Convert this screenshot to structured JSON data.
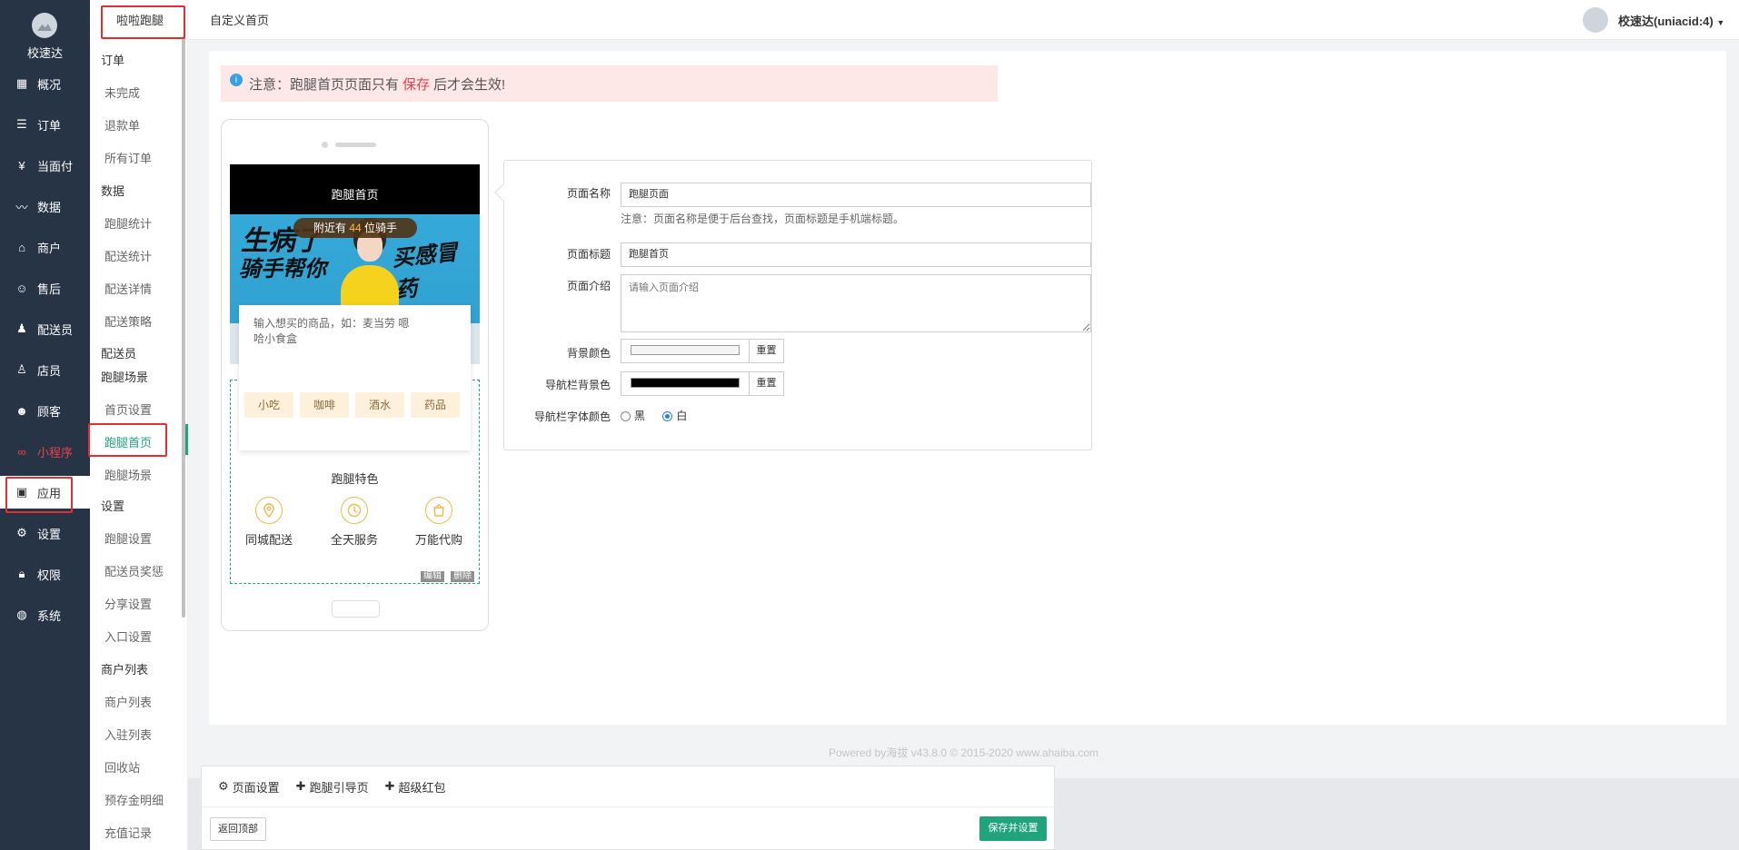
{
  "nav": {
    "brand": "校速达",
    "items": [
      {
        "label": "概况",
        "icon": "overview-icon"
      },
      {
        "label": "订单",
        "icon": "order-icon"
      },
      {
        "label": "当面付",
        "icon": "yen-icon"
      },
      {
        "label": "数据",
        "icon": "chart-icon"
      },
      {
        "label": "商户",
        "icon": "store-icon"
      },
      {
        "label": "售后",
        "icon": "service-icon"
      },
      {
        "label": "配送员",
        "icon": "courier-icon"
      },
      {
        "label": "店员",
        "icon": "clerk-icon"
      },
      {
        "label": "顾客",
        "icon": "customer-icon"
      },
      {
        "label": "小程序",
        "icon": "miniprogram-icon"
      },
      {
        "label": "应用",
        "icon": "apps-icon"
      },
      {
        "label": "设置",
        "icon": "gear-icon"
      },
      {
        "label": "权限",
        "icon": "lock-icon"
      },
      {
        "label": "系统",
        "icon": "system-icon"
      }
    ]
  },
  "subnav": {
    "top": "啦啦跑腿",
    "groups": [
      {
        "head": "订单",
        "items": [
          "未完成",
          "退款单",
          "所有订单"
        ]
      },
      {
        "head": "数据",
        "items": [
          "跑腿统计",
          "配送统计",
          "配送详情",
          "配送策略"
        ]
      },
      {
        "head": "配送员",
        "items": []
      },
      {
        "head": "跑腿场景",
        "items": [
          "首页设置",
          "跑腿首页",
          "跑腿场景"
        ]
      },
      {
        "head": "设置",
        "items": [
          "跑腿设置",
          "配送员奖惩",
          "分享设置",
          "入口设置"
        ]
      },
      {
        "head": "商户列表",
        "items": [
          "商户列表",
          "入驻列表",
          "回收站",
          "预存金明细",
          "充值记录"
        ]
      }
    ]
  },
  "header": {
    "title": "自定义首页",
    "user": "校速达(uniacid:4)"
  },
  "notice": {
    "prefix": "注意：跑腿首页页面只有",
    "highlight": "保存",
    "suffix": "后才会生效!"
  },
  "phone": {
    "title": "跑腿首页",
    "banner_line1": "生病了",
    "banner_line2": "骑手帮你",
    "banner_line3": "买感冒药",
    "riders_prefix": "附近有",
    "riders_count": "44",
    "riders_suffix": "位骑手",
    "search_placeholder": "输入想买的商品，如：麦当劳 嗯哈小食盒",
    "tags": [
      "小吃",
      "咖啡",
      "酒水",
      "药品"
    ],
    "features_title": "跑腿特色",
    "features": [
      {
        "label": "同城配送",
        "icon": "location-pin-icon"
      },
      {
        "label": "全天服务",
        "icon": "clock-icon"
      },
      {
        "label": "万能代购",
        "icon": "shopping-bag-icon"
      }
    ],
    "mini_buttons": [
      "编辑",
      "删除"
    ]
  },
  "form": {
    "page_name_label": "页面名称",
    "page_name_value": "跑腿页面",
    "page_name_help": "注意：页面名称是便于后台查找，页面标题是手机端标题。",
    "page_title_label": "页面标题",
    "page_title_value": "跑腿首页",
    "page_intro_label": "页面介绍",
    "page_intro_placeholder": "请输入页面介绍",
    "bg_color_label": "背景颜色",
    "bg_color_value": "#f5f5f5",
    "nav_bg_label": "导航栏背景色",
    "nav_bg_value": "#000000",
    "reset_label": "重置",
    "nav_font_label": "导航栏字体颜色",
    "font_options": [
      "黑",
      "白"
    ],
    "font_selected": "白"
  },
  "footer": {
    "powered": "Powered by海拔 v43.8.0 © 2015-2020 www.ahaiba.com",
    "tabs": [
      {
        "icon": "gear-icon",
        "label": "页面设置"
      },
      {
        "icon": "plus-icon",
        "label": "跑腿引导页"
      },
      {
        "icon": "plus-icon",
        "label": "超级红包"
      }
    ],
    "back_label": "返回顶部",
    "save_label": "保存并设置"
  },
  "colors": {
    "accent": "#21a37c",
    "nav_bg": "#273446",
    "alert": "#e8414c"
  }
}
